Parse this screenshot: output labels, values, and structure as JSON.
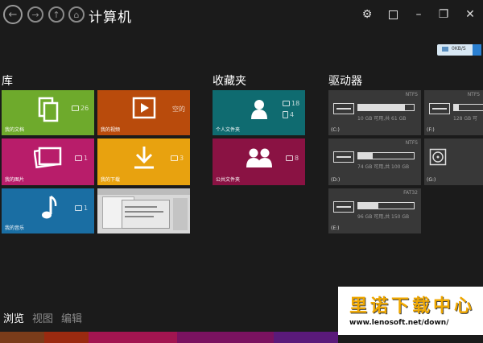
{
  "header": {
    "title": "计算机",
    "speed_badge": "0KB/S"
  },
  "sections": {
    "library": "库",
    "favorites": "收藏夹",
    "drives": "驱动器"
  },
  "library_tiles": [
    {
      "label": "我的文档",
      "count": "26",
      "color": "#6eaa2c"
    },
    {
      "label": "我的视频",
      "count": "空的",
      "color": "#b94b0c"
    },
    {
      "label": "我的图片",
      "count": "1",
      "color": "#b81d6a"
    },
    {
      "label": "我的下载",
      "count": "3",
      "color": "#e8a20f"
    },
    {
      "label": "我的音乐",
      "count": "1",
      "color": "#1a6ea3"
    }
  ],
  "favorite_tiles": [
    {
      "label": "个人文件夹",
      "count1": "18",
      "count2": "4",
      "color": "#0f6b70"
    },
    {
      "label": "公共文件夹",
      "count": "8",
      "color": "#8a1243"
    }
  ],
  "drives": [
    {
      "letter": "(C:)",
      "fs": "NTFS",
      "usage": "10 GB 可用,共 61 GB",
      "used_pct": 84
    },
    {
      "letter": "(F:)",
      "fs": "NTFS",
      "usage": "128 GB 可",
      "used_pct": 15
    },
    {
      "letter": "(D:)",
      "fs": "NTFS",
      "usage": "74 GB 可用,共 100 GB",
      "used_pct": 26
    },
    {
      "letter": "(G:)",
      "fs": "",
      "usage": "",
      "used_pct": 0
    },
    {
      "letter": "(E:)",
      "fs": "FAT32",
      "usage": "96 GB 可用,共 150 GB",
      "used_pct": 36
    }
  ],
  "bottom_tabs": [
    "浏览",
    "视图",
    "编辑"
  ],
  "watermark": {
    "main": "里诺下载中心",
    "url": "www.lenosoft.net/down/"
  },
  "icons": {
    "back": "back-arrow-icon",
    "forward": "forward-arrow-icon",
    "up": "up-arrow-icon",
    "home": "home-icon",
    "settings": "gear-icon",
    "restore": "restore-icon",
    "minimize": "minimize-icon",
    "maximize": "maximize-icon",
    "close": "close-icon"
  }
}
